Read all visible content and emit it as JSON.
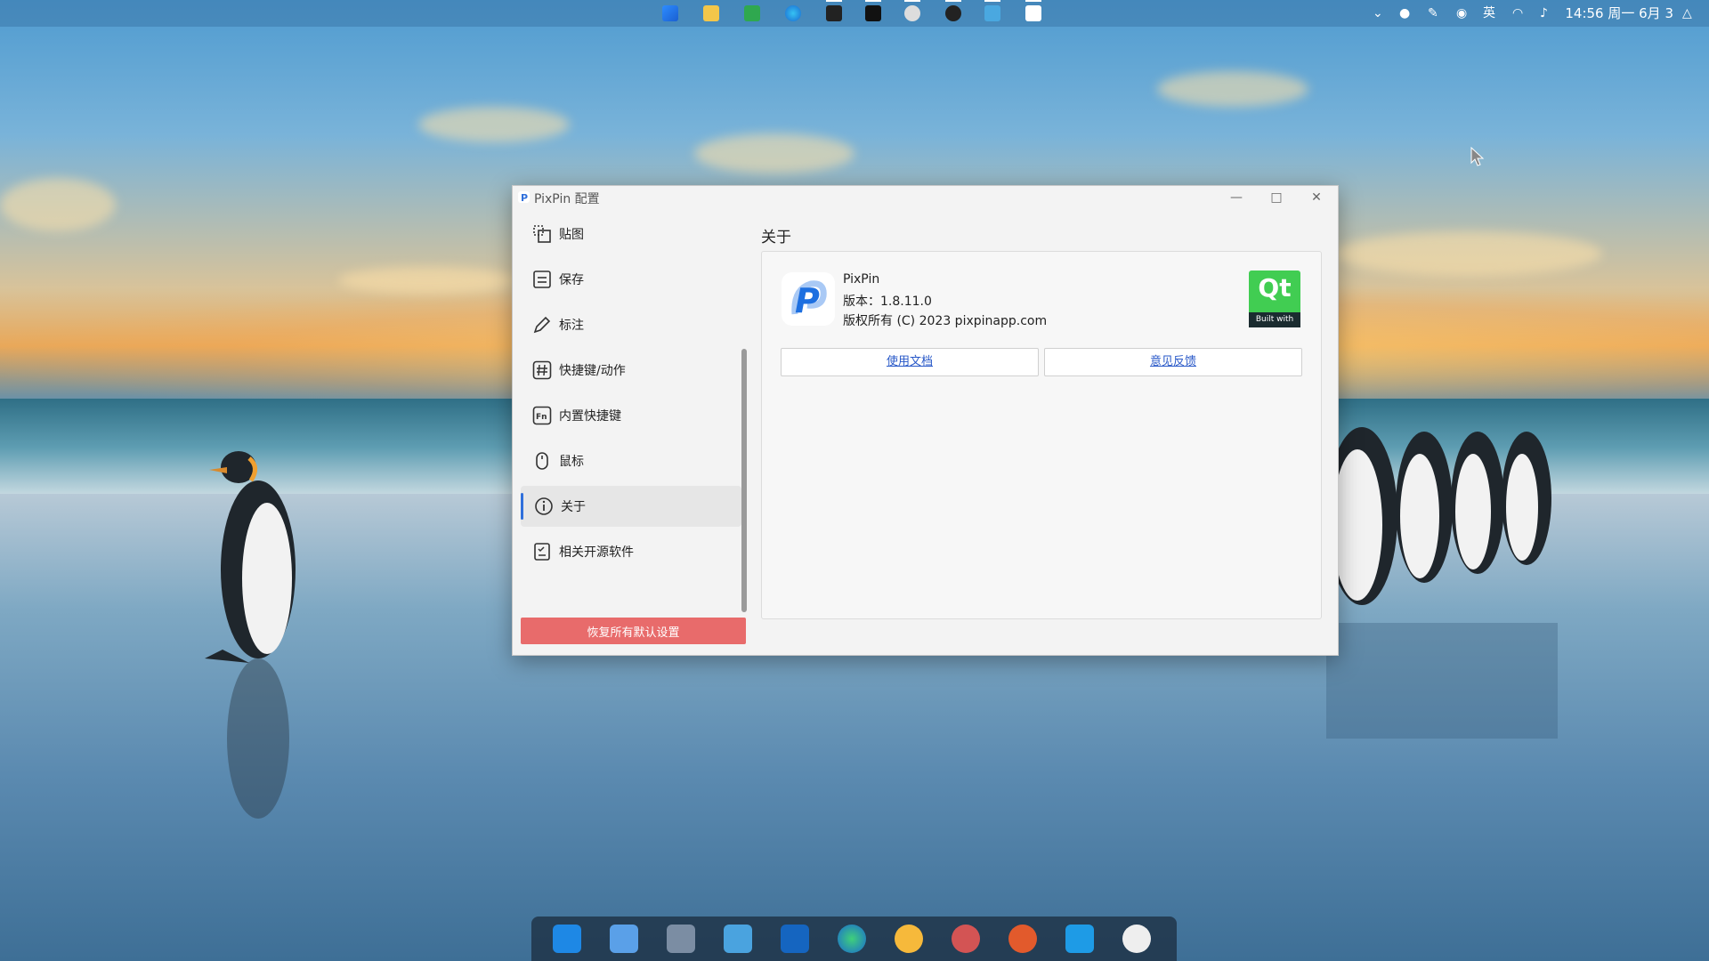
{
  "topbar": {
    "pinned_apps": [
      "windows-start-icon",
      "file-explorer-icon",
      "app-green-icon",
      "edge-icon",
      "app-dark-icon",
      "tiktok-icon",
      "app-disc-icon",
      "obs-icon",
      "app-screen-icon",
      "pixpin-icon"
    ],
    "tray": {
      "ime": "英",
      "time_date": "14:56 周一 6月 3"
    }
  },
  "window": {
    "title": "PixPin 配置",
    "sidebar": {
      "items": [
        {
          "label": "贴图",
          "icon": "pin-image-icon"
        },
        {
          "label": "保存",
          "icon": "save-icon"
        },
        {
          "label": "标注",
          "icon": "pencil-icon"
        },
        {
          "label": "快捷键/动作",
          "icon": "hash-icon"
        },
        {
          "label": "内置快捷键",
          "icon": "fn-key-icon"
        },
        {
          "label": "鼠标",
          "icon": "mouse-icon"
        },
        {
          "label": "关于",
          "icon": "info-icon",
          "active": true
        },
        {
          "label": "相关开源软件",
          "icon": "checklist-icon"
        }
      ],
      "reset_label": "恢复所有默认设置"
    },
    "about": {
      "heading": "关于",
      "app_name": "PixPin",
      "version": "版本：1.8.11.0",
      "copyright": "版权所有 (C) 2023 pixpinapp.com",
      "qt_text": "Qt",
      "qt_sub": "Built with",
      "docs_link": "使用文档",
      "feedback_link": "意见反馈"
    }
  },
  "taskbar": {
    "apps": [
      "mail-icon",
      "notepad-icon",
      "calculator-icon",
      "desktop-icon",
      "security-shield-icon",
      "edge-icon",
      "weather-icon",
      "music-icon",
      "media-player-icon",
      "skype-icon",
      "clock-icon"
    ]
  },
  "colors": {
    "accent": "#2f6fdb",
    "reset": "#e86b6b",
    "qt_green": "#41cd52",
    "link": "#2858c8"
  }
}
